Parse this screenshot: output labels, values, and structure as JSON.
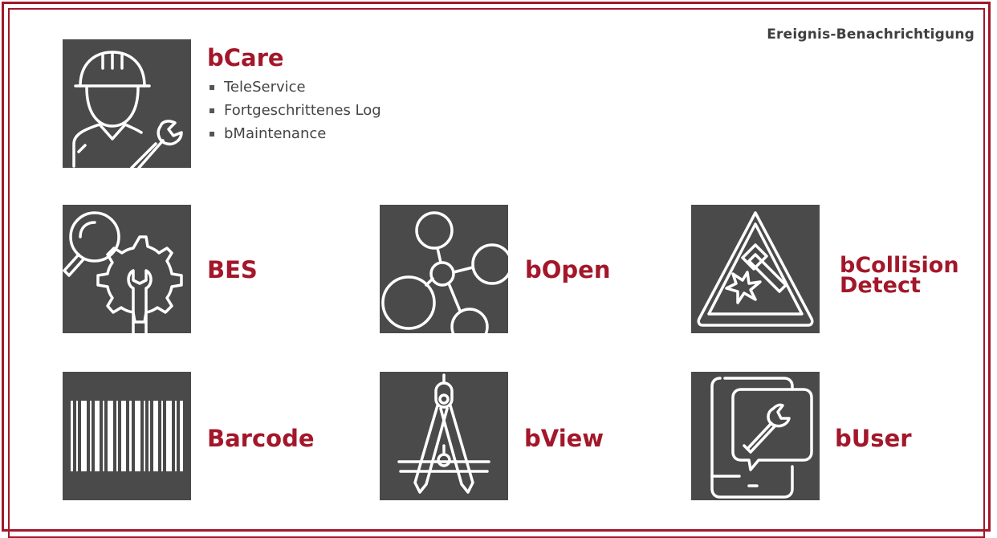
{
  "header": {
    "label": "Ereignis-Benachrichtigung"
  },
  "bcare": {
    "title": "bCare",
    "items": [
      "TeleService",
      "Fortgeschrittenes Log",
      "bMaintenance"
    ],
    "icon": "worker-with-wrench-icon"
  },
  "tiles": {
    "bes": {
      "title": "BES",
      "icon": "magnifier-gear-wrench-icon"
    },
    "bopen": {
      "title": "bOpen",
      "icon": "network-nodes-icon"
    },
    "bcollision": {
      "line1": "bCollision",
      "line2": "Detect",
      "icon": "collision-warning-icon"
    },
    "barcode": {
      "title": "Barcode",
      "icon": "barcode-icon"
    },
    "bview": {
      "title": "bView",
      "icon": "compass-drafting-icon"
    },
    "buser": {
      "title": "bUser",
      "icon": "tablet-wrench-icon"
    }
  },
  "colors": {
    "accent": "#a3172a",
    "tile": "#4a4a4a",
    "text": "#444444"
  }
}
